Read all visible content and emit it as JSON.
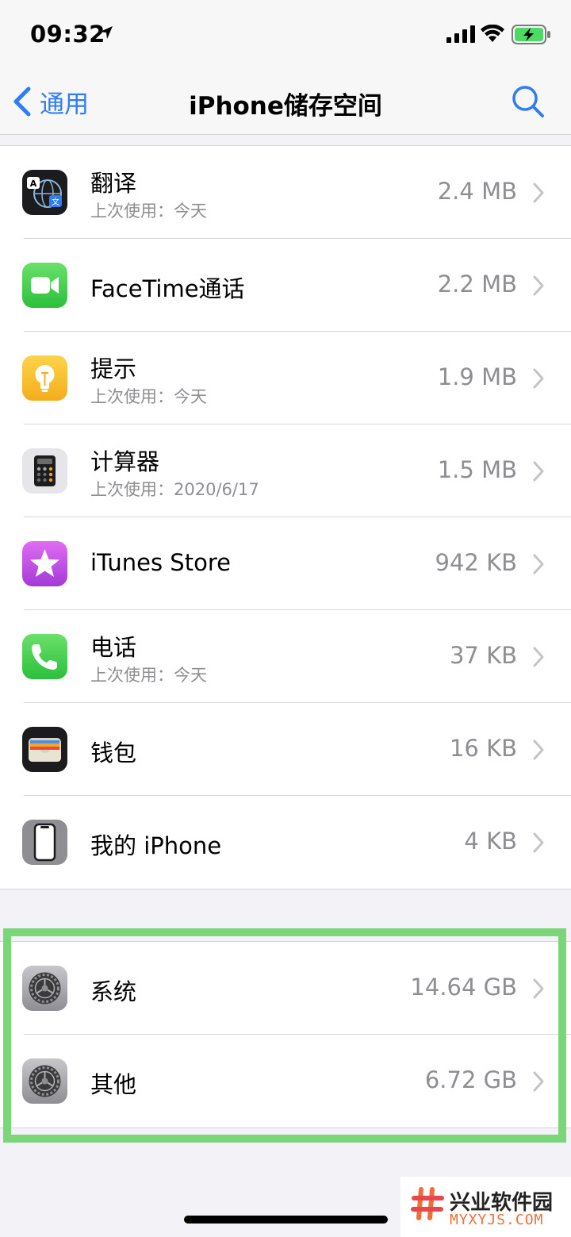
{
  "status_bar": {
    "time": "09:32"
  },
  "nav": {
    "back_label": "通用",
    "title": "iPhone储存空间"
  },
  "colors": {
    "accent": "#2f7cf6",
    "highlight": "#7bd677",
    "secondary_text": "#8e8e93",
    "separator": "#d6d6da"
  },
  "apps": [
    {
      "name": "翻译",
      "last_used": "上次使用：今天",
      "size": "2.4 MB",
      "icon": "translate-icon"
    },
    {
      "name": "FaceTime通话",
      "last_used": "",
      "size": "2.2 MB",
      "icon": "facetime-icon"
    },
    {
      "name": "提示",
      "last_used": "上次使用：今天",
      "size": "1.9 MB",
      "icon": "tips-icon"
    },
    {
      "name": "计算器",
      "last_used": "上次使用：2020/6/17",
      "size": "1.5 MB",
      "icon": "calculator-icon"
    },
    {
      "name": "iTunes Store",
      "last_used": "",
      "size": "942 KB",
      "icon": "itunes-store-icon"
    },
    {
      "name": "电话",
      "last_used": "上次使用：今天",
      "size": "37 KB",
      "icon": "phone-icon"
    },
    {
      "name": "钱包",
      "last_used": "",
      "size": "16 KB",
      "icon": "wallet-icon"
    },
    {
      "name": "我的 iPhone",
      "last_used": "",
      "size": "4 KB",
      "icon": "my-iphone-icon"
    }
  ],
  "system_items": [
    {
      "name": "系统",
      "size": "14.64 GB",
      "icon": "settings-gear-icon"
    },
    {
      "name": "其他",
      "size": "6.72 GB",
      "icon": "settings-gear-icon"
    }
  ],
  "watermark": {
    "title": "兴业软件园",
    "url": "MYXYJS.COM"
  }
}
